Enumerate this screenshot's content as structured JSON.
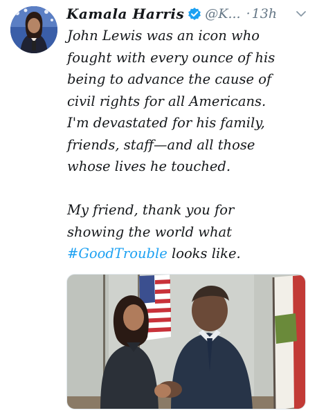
{
  "author": {
    "name": "Kamala Harris",
    "handle": "@K...",
    "separator": "·",
    "time": "13h"
  },
  "tweet": {
    "paragraph1": [
      "John Lewis was an icon who",
      "fought with every ounce of his",
      "being to advance the cause of",
      "civil rights for all Americans.",
      "I'm devastated for his family,",
      "friends, staff—and all those",
      "whose lives he touched."
    ],
    "paragraph2": [
      "My friend, thank you for",
      "showing the world what"
    ],
    "hashtag": "#GoodTrouble",
    "closing": " looks like."
  },
  "icons": {
    "verified": "verified-badge-icon",
    "caret": "chevron-down-icon"
  },
  "colors": {
    "text": "#14171a",
    "muted": "#657786",
    "link": "#1da1f2"
  }
}
